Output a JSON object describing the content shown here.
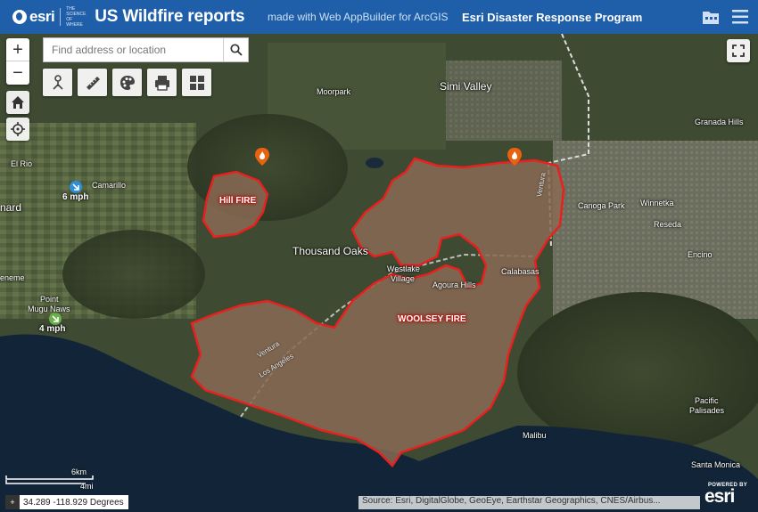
{
  "header": {
    "logo_text": "esri",
    "logo_tagline": "THE SCIENCE OF WHERE",
    "title": "US Wildfire reports",
    "subtitle": "made with Web AppBuilder for ArcGIS",
    "program": "Esri Disaster Response Program"
  },
  "search": {
    "placeholder": "Find address or location"
  },
  "toolbar": {
    "items": [
      "directions-icon",
      "measure-icon",
      "basemap-gallery-icon",
      "print-icon",
      "layer-list-icon"
    ]
  },
  "map": {
    "places": {
      "moorpark": "Moorpark",
      "simi_valley": "Simi Valley",
      "granada_hills": "Granada Hills",
      "el_rio": "El Rio",
      "camarillo": "Camarillo",
      "oxnard": "nard",
      "ventura_fwy": "Ventura",
      "winnetka": "Winnetka",
      "canoga_park": "Canoga Park",
      "reseda": "Reseda",
      "thousand_oaks": "Thousand Oaks",
      "westlake": "Westlake",
      "westlake2": "Village",
      "calabasas": "Calabasas",
      "encino": "Encino",
      "agoura_hills": "Agoura Hills",
      "hueneme": "eneme",
      "point_mugu": "Point",
      "point_mugu2": "Mugu Naws",
      "pacific": "Pacific",
      "palisades": "Palisades",
      "malibu": "Malibu",
      "santa_monica": "Santa Monica"
    },
    "roads": {
      "ventura": "Ventura",
      "los_angeles": "Los Angeles"
    },
    "fires": {
      "hill": "Hill FIRE",
      "woolsey": "WOOLSEY FIRE"
    },
    "wind": [
      {
        "speed": "6 mph",
        "color": "#2f8fd8"
      },
      {
        "speed": "4 mph",
        "color": "#6ab04c"
      }
    ],
    "fire_color": "#e8201e",
    "burn_fill": "#8a6a55"
  },
  "scale": {
    "km": "6km",
    "mi": "4mi"
  },
  "coordinates": "34.289 -118.929 Degrees",
  "attribution": "Source: Esri, DigitalGlobe, GeoEye, Earthstar Geographics, CNES/Airbus...",
  "powered": {
    "by": "POWERED BY",
    "brand": "esri"
  }
}
